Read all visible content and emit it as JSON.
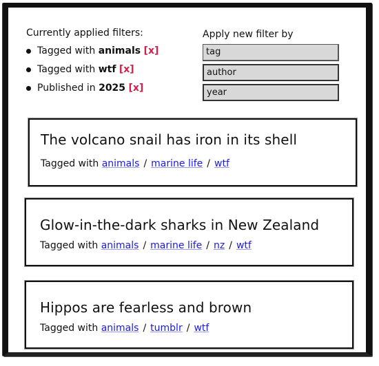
{
  "current_filters": {
    "heading": "Currently applied filters:",
    "items": [
      {
        "prefix": "Tagged with",
        "value": "animals",
        "remove": "[x]"
      },
      {
        "prefix": "Tagged with",
        "value": "wtf",
        "remove": "[x]"
      },
      {
        "prefix": "Published in",
        "value": "2025",
        "remove": "[x]"
      }
    ]
  },
  "apply_filter": {
    "heading": "Apply new filter by",
    "options": [
      "tag",
      "author",
      "year"
    ]
  },
  "posts": [
    {
      "title": "The volcano snail has iron in its shell",
      "tag_prefix": "Tagged with",
      "tags": [
        "animals",
        "marine life",
        "wtf"
      ]
    },
    {
      "title": "Glow-in-the-dark sharks in New Zealand",
      "tag_prefix": "Tagged with",
      "tags": [
        "animals",
        "marine life",
        "nz",
        "wtf"
      ]
    },
    {
      "title": "Hippos are fearless and brown",
      "tag_prefix": "Tagged with",
      "tags": [
        "animals",
        "tumblr",
        "wtf"
      ]
    }
  ],
  "colors": {
    "remove": "#d4204a",
    "link": "#1a1ae6"
  }
}
